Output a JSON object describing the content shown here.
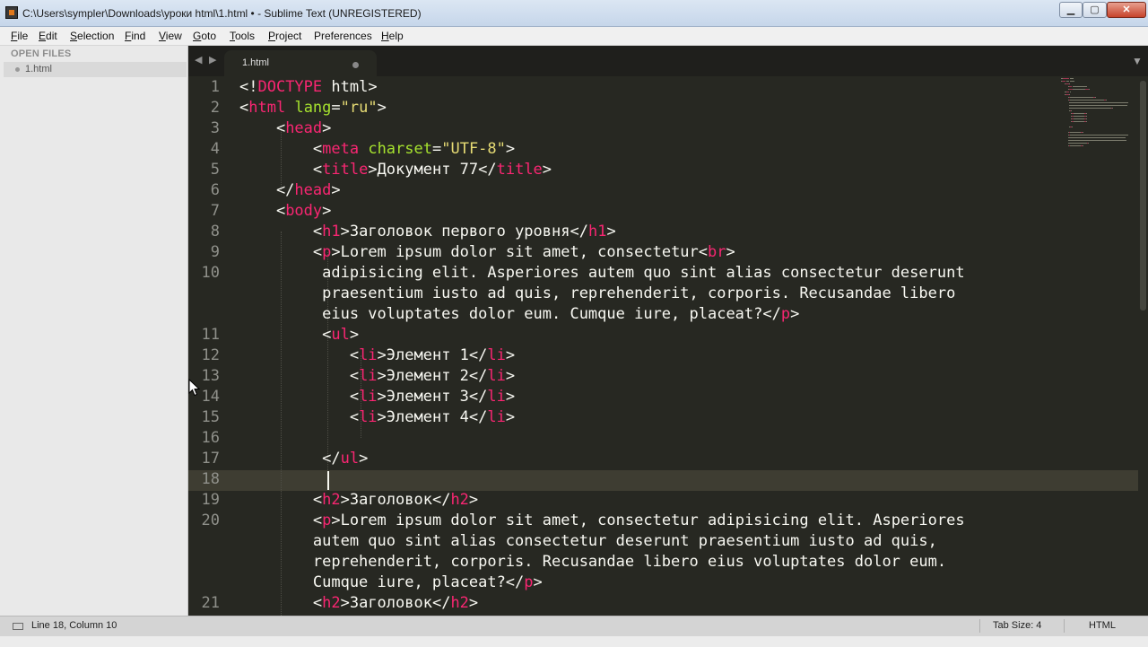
{
  "window": {
    "title": "C:\\Users\\sympler\\Downloads\\уроки html\\1.html • - Sublime Text (UNREGISTERED)",
    "min_glyph": "▁",
    "max_glyph": "▢",
    "close_glyph": "✕"
  },
  "menu": [
    {
      "label": "File",
      "u": "F",
      "rest": "ile"
    },
    {
      "label": "Edit",
      "u": "E",
      "rest": "dit"
    },
    {
      "label": "Selection",
      "u": "S",
      "rest": "election"
    },
    {
      "label": "Find",
      "u": "F",
      "rest": "ind"
    },
    {
      "label": "View",
      "u": "V",
      "rest": "iew"
    },
    {
      "label": "Goto",
      "u": "G",
      "rest": "oto"
    },
    {
      "label": "Tools",
      "u": "T",
      "rest": "ools"
    },
    {
      "label": "Project",
      "u": "P",
      "rest": "roject"
    },
    {
      "label": "Preferences",
      "u": "",
      "rest": "Preferences"
    },
    {
      "label": "Help",
      "u": "H",
      "rest": "elp"
    }
  ],
  "sidebar": {
    "heading": "OPEN FILES",
    "files": [
      "1.html"
    ]
  },
  "tabs": {
    "nav_left": "◀",
    "nav_right": "▶",
    "active_label": "1.html",
    "menu_glyph": "▼"
  },
  "editor": {
    "gutter": [
      "1",
      "2",
      "3",
      "4",
      "5",
      "6",
      "7",
      "8",
      "9",
      "10",
      "",
      "",
      "11",
      "12",
      "13",
      "14",
      "15",
      "16",
      "17",
      "18",
      "19",
      "20",
      "",
      "",
      "",
      "21"
    ],
    "lines": [
      [
        [
          "p",
          "<!"
        ],
        [
          "t",
          "DOCTYPE"
        ],
        [
          "p",
          " html>"
        ]
      ],
      [
        [
          "p",
          "<"
        ],
        [
          "t",
          "html"
        ],
        [
          "p",
          " "
        ],
        [
          "a",
          "lang"
        ],
        [
          "p",
          "="
        ],
        [
          "s",
          "\"ru\""
        ],
        [
          "p",
          ">"
        ]
      ],
      [
        [
          "p",
          "    <"
        ],
        [
          "t",
          "head"
        ],
        [
          "p",
          ">"
        ]
      ],
      [
        [
          "p",
          "        <"
        ],
        [
          "t",
          "meta"
        ],
        [
          "p",
          " "
        ],
        [
          "a",
          "charset"
        ],
        [
          "p",
          "="
        ],
        [
          "s",
          "\"UTF-8\""
        ],
        [
          "p",
          ">"
        ]
      ],
      [
        [
          "p",
          "        <"
        ],
        [
          "t",
          "title"
        ],
        [
          "p",
          ">Документ 77</"
        ],
        [
          "t",
          "title"
        ],
        [
          "p",
          ">"
        ]
      ],
      [
        [
          "p",
          "    </"
        ],
        [
          "t",
          "head"
        ],
        [
          "p",
          ">"
        ]
      ],
      [
        [
          "p",
          "    <"
        ],
        [
          "t",
          "body"
        ],
        [
          "p",
          ">"
        ]
      ],
      [
        [
          "p",
          "        <"
        ],
        [
          "t",
          "h1"
        ],
        [
          "p",
          ">Заголовок первого уровня</"
        ],
        [
          "t",
          "h1"
        ],
        [
          "p",
          ">"
        ]
      ],
      [
        [
          "p",
          "        <"
        ],
        [
          "t",
          "p"
        ],
        [
          "p",
          ">Lorem ipsum dolor sit amet, consectetur<"
        ],
        [
          "t",
          "br"
        ],
        [
          "p",
          ">"
        ]
      ],
      [
        [
          "p",
          "         adipisicing elit. Asperiores autem quo sint alias consectetur deserunt"
        ]
      ],
      [
        [
          "p",
          "         praesentium iusto ad quis, reprehenderit, corporis. Recusandae libero"
        ]
      ],
      [
        [
          "p",
          "         eius voluptates dolor eum. Cumque iure, placeat?</"
        ],
        [
          "t",
          "p"
        ],
        [
          "p",
          ">"
        ]
      ],
      [
        [
          "p",
          "         <"
        ],
        [
          "t",
          "ul"
        ],
        [
          "p",
          ">"
        ]
      ],
      [
        [
          "p",
          "            <"
        ],
        [
          "t",
          "li"
        ],
        [
          "p",
          ">Элемент 1</"
        ],
        [
          "t",
          "li"
        ],
        [
          "p",
          ">"
        ]
      ],
      [
        [
          "p",
          "            <"
        ],
        [
          "t",
          "li"
        ],
        [
          "p",
          ">Элемент 2</"
        ],
        [
          "t",
          "li"
        ],
        [
          "p",
          ">"
        ]
      ],
      [
        [
          "p",
          "            <"
        ],
        [
          "t",
          "li"
        ],
        [
          "p",
          ">Элемент 3</"
        ],
        [
          "t",
          "li"
        ],
        [
          "p",
          ">"
        ]
      ],
      [
        [
          "p",
          "            <"
        ],
        [
          "t",
          "li"
        ],
        [
          "p",
          ">Элемент 4</"
        ],
        [
          "t",
          "li"
        ],
        [
          "p",
          ">"
        ]
      ],
      [
        [
          "p",
          ""
        ]
      ],
      [
        [
          "p",
          "         </"
        ],
        [
          "t",
          "ul"
        ],
        [
          "p",
          ">"
        ]
      ],
      [
        [
          "p",
          ""
        ]
      ],
      [
        [
          "p",
          "        <"
        ],
        [
          "t",
          "h2"
        ],
        [
          "p",
          ">Заголовок</"
        ],
        [
          "t",
          "h2"
        ],
        [
          "p",
          ">"
        ]
      ],
      [
        [
          "p",
          "        <"
        ],
        [
          "t",
          "p"
        ],
        [
          "p",
          ">Lorem ipsum dolor sit amet, consectetur adipisicing elit. Asperiores"
        ]
      ],
      [
        [
          "p",
          "        autem quo sint alias consectetur deserunt praesentium iusto ad quis,"
        ]
      ],
      [
        [
          "p",
          "        reprehenderit, corporis. Recusandae libero eius voluptates dolor eum."
        ]
      ],
      [
        [
          "p",
          "        Cumque iure, placeat?</"
        ],
        [
          "t",
          "p"
        ],
        [
          "p",
          ">"
        ]
      ],
      [
        [
          "p",
          "        <"
        ],
        [
          "t",
          "h2"
        ],
        [
          "p",
          ">Заголовок</"
        ],
        [
          "t",
          "h2"
        ],
        [
          "p",
          ">"
        ]
      ]
    ]
  },
  "status": {
    "text": "Line 18, Column 10",
    "tab_size": "Tab Size: 4",
    "syntax": "HTML"
  }
}
